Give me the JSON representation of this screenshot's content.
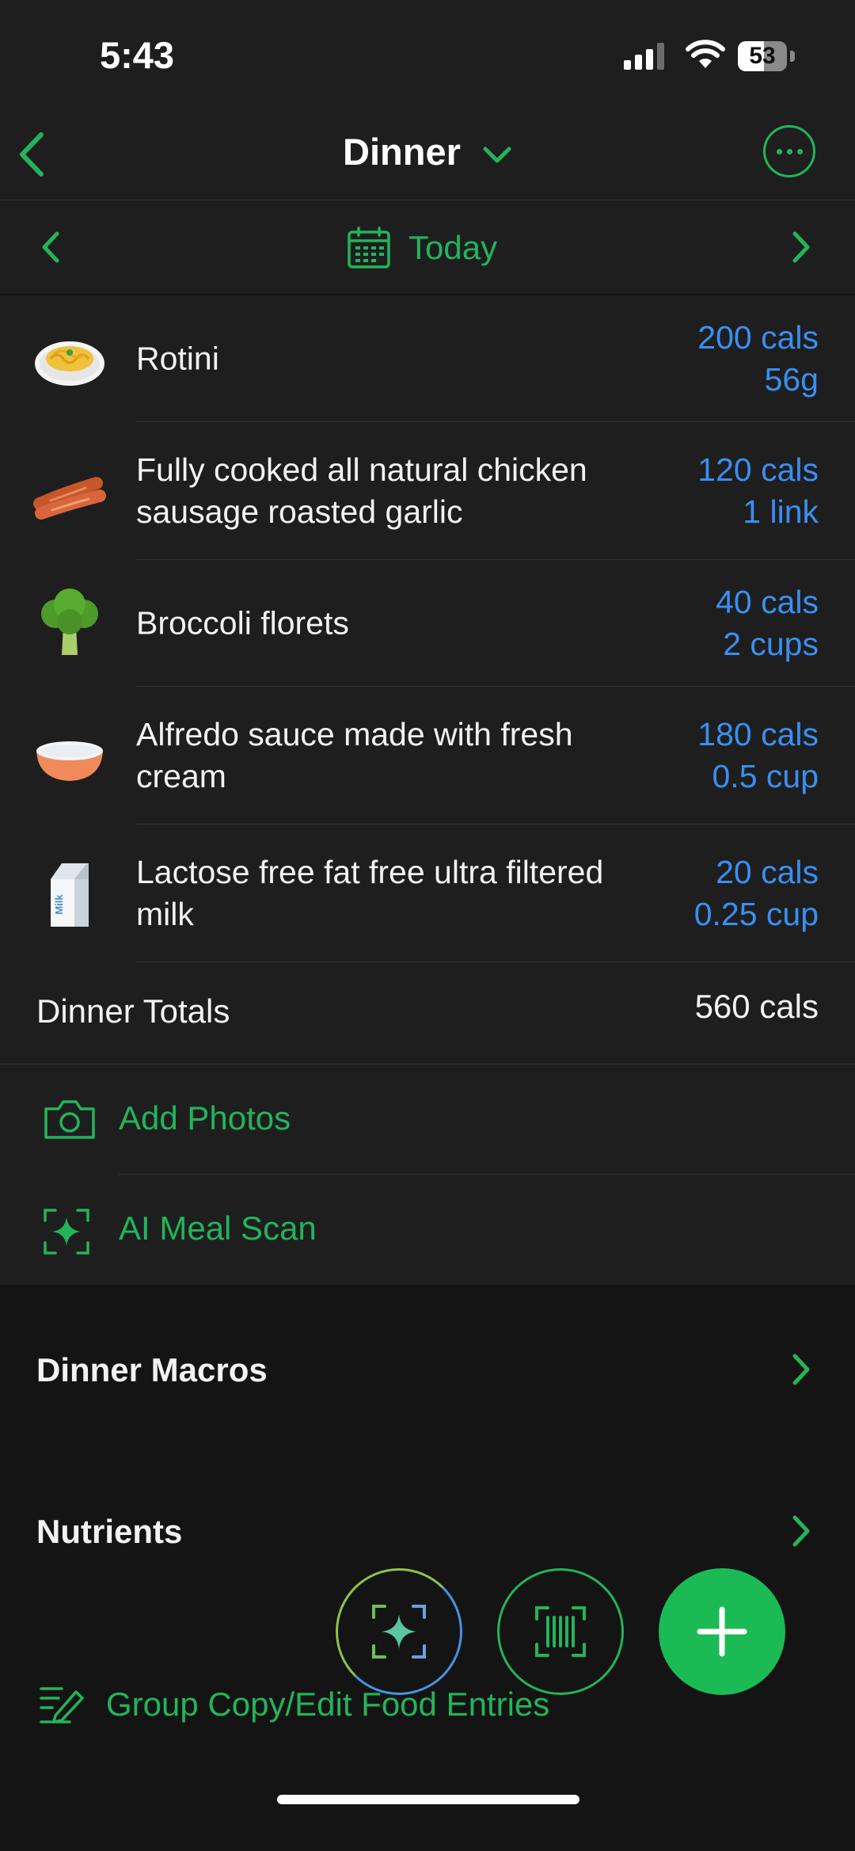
{
  "status": {
    "time": "5:43",
    "battery": "53"
  },
  "nav": {
    "title": "Dinner"
  },
  "date": {
    "label": "Today"
  },
  "foods": [
    {
      "name": "Rotini",
      "cals": "200 cals",
      "amount": "56g",
      "icon": "pasta-icon"
    },
    {
      "name": "Fully cooked all natural chicken sausage roasted garlic",
      "cals": "120 cals",
      "amount": "1 link",
      "icon": "sausage-icon"
    },
    {
      "name": "Broccoli florets",
      "cals": "40 cals",
      "amount": "2 cups",
      "icon": "broccoli-icon"
    },
    {
      "name": "Alfredo sauce made with fresh cream",
      "cals": "180 cals",
      "amount": "0.5 cup",
      "icon": "bowl-icon"
    },
    {
      "name": "Lactose free fat free ultra filtered milk",
      "cals": "20 cals",
      "amount": "0.25 cup",
      "icon": "milk-carton-icon"
    }
  ],
  "totals": {
    "label": "Dinner Totals",
    "value": "560 cals"
  },
  "actions": {
    "add_photos": "Add Photos",
    "ai_meal_scan": "AI Meal Scan"
  },
  "sections": {
    "macros": "Dinner Macros",
    "nutrients": "Nutrients"
  },
  "group_copy": "Group Copy/Edit Food Entries",
  "colors": {
    "accent": "#23b45a",
    "value_blue": "#3a8ff0",
    "background": "#141414",
    "card": "#1e1e1f"
  }
}
